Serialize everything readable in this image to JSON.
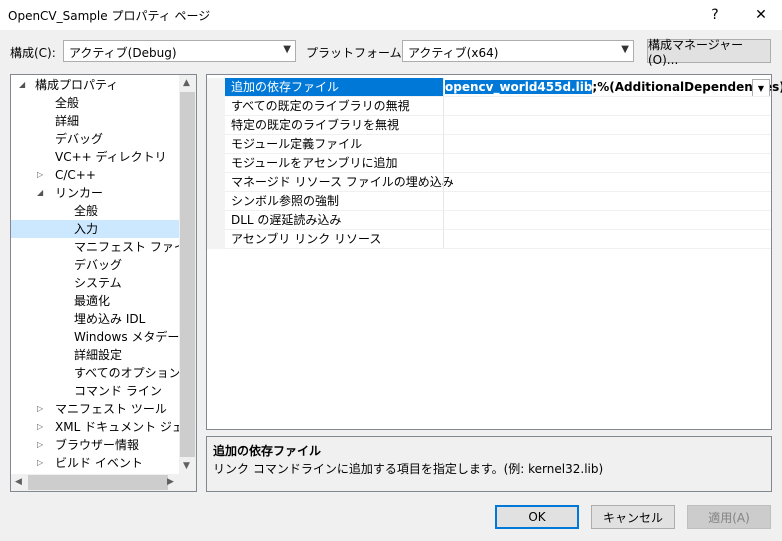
{
  "window": {
    "title": "OpenCV_Sample プロパティ ページ",
    "help_glyph": "?",
    "close_glyph": "✕"
  },
  "toolbar": {
    "config_label": "構成(C):",
    "config_value": "アクティブ(Debug)",
    "platform_label": "プラットフォーム(P):",
    "platform_value": "アクティブ(x64)",
    "config_manager_label": "構成マネージャー(O)..."
  },
  "tree": {
    "items": [
      {
        "label": "構成プロパティ",
        "level": 0,
        "expander": "◢"
      },
      {
        "label": "全般",
        "level": 1,
        "expander": ""
      },
      {
        "label": "詳細",
        "level": 1,
        "expander": ""
      },
      {
        "label": "デバッグ",
        "level": 1,
        "expander": ""
      },
      {
        "label": "VC++ ディレクトリ",
        "level": 1,
        "expander": ""
      },
      {
        "label": "C/C++",
        "level": 1,
        "expander": "▷"
      },
      {
        "label": "リンカー",
        "level": 1,
        "expander": "◢"
      },
      {
        "label": "全般",
        "level": 2,
        "expander": ""
      },
      {
        "label": "入力",
        "level": 2,
        "expander": "",
        "selected": true
      },
      {
        "label": "マニフェスト ファイル",
        "level": 2,
        "expander": ""
      },
      {
        "label": "デバッグ",
        "level": 2,
        "expander": ""
      },
      {
        "label": "システム",
        "level": 2,
        "expander": ""
      },
      {
        "label": "最適化",
        "level": 2,
        "expander": ""
      },
      {
        "label": "埋め込み IDL",
        "level": 2,
        "expander": ""
      },
      {
        "label": "Windows メタデータ",
        "level": 2,
        "expander": ""
      },
      {
        "label": "詳細設定",
        "level": 2,
        "expander": ""
      },
      {
        "label": "すべてのオプション",
        "level": 2,
        "expander": ""
      },
      {
        "label": "コマンド ライン",
        "level": 2,
        "expander": ""
      },
      {
        "label": "マニフェスト ツール",
        "level": 1,
        "expander": "▷"
      },
      {
        "label": "XML ドキュメント ジェネレー",
        "level": 1,
        "expander": "▷"
      },
      {
        "label": "ブラウザー情報",
        "level": 1,
        "expander": "▷"
      },
      {
        "label": "ビルド イベント",
        "level": 1,
        "expander": "▷"
      }
    ]
  },
  "grid": {
    "rows": [
      {
        "name": "追加の依存ファイル",
        "value_selected": "opencv_world455d.lib",
        "value_rest": ";%(AdditionalDependencies)",
        "selected": true
      },
      {
        "name": "すべての既定のライブラリの無視",
        "value_selected": "",
        "value_rest": ""
      },
      {
        "name": "特定の既定のライブラリを無視",
        "value_selected": "",
        "value_rest": ""
      },
      {
        "name": "モジュール定義ファイル",
        "value_selected": "",
        "value_rest": ""
      },
      {
        "name": "モジュールをアセンブリに追加",
        "value_selected": "",
        "value_rest": ""
      },
      {
        "name": "マネージド リソース ファイルの埋め込み",
        "value_selected": "",
        "value_rest": ""
      },
      {
        "name": "シンボル参照の強制",
        "value_selected": "",
        "value_rest": ""
      },
      {
        "name": "DLL の遅延読み込み",
        "value_selected": "",
        "value_rest": ""
      },
      {
        "name": "アセンブリ リンク リソース",
        "value_selected": "",
        "value_rest": ""
      }
    ]
  },
  "description": {
    "title": "追加の依存ファイル",
    "text": "リンク コマンドラインに追加する項目を指定します。(例: kernel32.lib)"
  },
  "buttons": {
    "ok": "OK",
    "cancel": "キャンセル",
    "apply": "適用(A)"
  }
}
